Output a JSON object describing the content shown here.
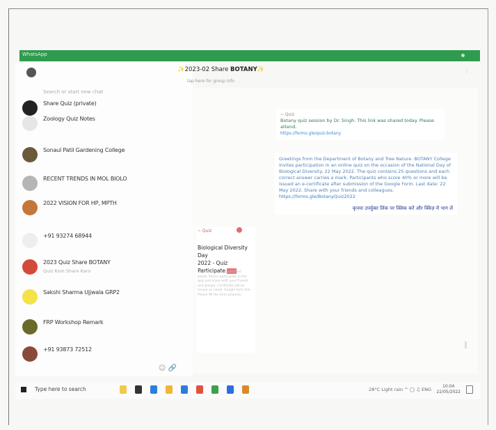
{
  "window": {
    "title": "WhatsApp"
  },
  "sidebar": {
    "search_placeholder": "Search or start new chat",
    "chats": [
      {
        "name": "Share Quiz (private)",
        "preview": "",
        "time": "",
        "avatar_color": "#222222"
      },
      {
        "name": "Zoology Quiz Notes",
        "preview": "",
        "time": "",
        "avatar_color": "#e6e6e6"
      },
      {
        "name": "Sonaul Patil Gardening College",
        "preview": "",
        "time": "",
        "avatar_color": "#6b5a3a"
      },
      {
        "name": "RECENT TRENDS IN MOL BIOLO",
        "preview": "",
        "time": "",
        "avatar_color": "#b5b5b5"
      },
      {
        "name": "2022 VISION FOR HP, MPTH",
        "preview": "",
        "time": "",
        "avatar_color": "#c4773a"
      },
      {
        "name": "+91 93274 68944",
        "preview": "",
        "time": "",
        "avatar_color": "#eeeeee"
      },
      {
        "name": "2023 Quiz Share BOTANY",
        "preview": "Quiz Kom Share Karo",
        "time": "",
        "avatar_color": "#d44a3a"
      },
      {
        "name": "Sakshi Sharma Ujjwala GRP2",
        "preview": "",
        "time": "",
        "avatar_color": "#f5e14a"
      },
      {
        "name": "FRP Workshop Remark",
        "preview": "",
        "time": "",
        "avatar_color": "#6a6a2a"
      },
      {
        "name": "+91 93873 72512",
        "preview": "",
        "time": "",
        "avatar_color": "#8a4a3a"
      }
    ]
  },
  "chat_header": {
    "title_prefix": "2023-02 Share",
    "title_bold": "BOTANY",
    "subtitle": "tap here for group info"
  },
  "messages": {
    "bubble1": {
      "from": "~ Quiz",
      "text": "Botany quiz session by Dr. Singh. This link was shared today. Please attend.",
      "link": "https://forms.gle/quiz-botany"
    },
    "bubble2": {
      "text": "Greetings from the Department of Botany and Tree Nature. BOTANY College invites participation in an online quiz on the occasion of the National Day of Biological Diversity. 22 May 2022. The quiz contains 25 questions and each correct answer carries a mark. Participants who score 40% or more will be issued an e-certificate after submission of the Google Form. Last date: 22 May 2022. Share with your friends and colleagues.",
      "link": "https://forms.gle/BotanyQuiz2022",
      "hindi": "कृपया उपर्युक्त लिंक पर क्लिक करें और क्विज़ में भाग लें"
    },
    "doc_card": {
      "top_label": "~ Quiz",
      "title_line1": "Biological Diversity Day",
      "title_line2": "2022 - Quiz",
      "title_line3": "Participate",
      "body": "Link for the quiz is provided below. Please participate in the quiz and share with your friends and groups. Certificate will be issued on email. Google form link. Please fill the form properly."
    }
  },
  "input": {
    "emoji_label": "☺",
    "attach_label": "🔗"
  },
  "taskbar": {
    "search_text": "Type here to search",
    "tray_text": "28°C  Light rain  ^  ◯  ♫  ENG",
    "time": "10:04",
    "date": "22/05/2022",
    "apps": [
      {
        "name": "task-view",
        "color": "#f2c94c"
      },
      {
        "name": "cortana",
        "color": "#333333"
      },
      {
        "name": "edge",
        "color": "#2d7ddc"
      },
      {
        "name": "file-explorer",
        "color": "#f2b632"
      },
      {
        "name": "store",
        "color": "#2d7ddc"
      },
      {
        "name": "chrome",
        "color": "#e0533d"
      },
      {
        "name": "chrome-2",
        "color": "#3ea04a"
      },
      {
        "name": "mail",
        "color": "#2d6ee0"
      },
      {
        "name": "photos",
        "color": "#d88a2e"
      }
    ]
  }
}
